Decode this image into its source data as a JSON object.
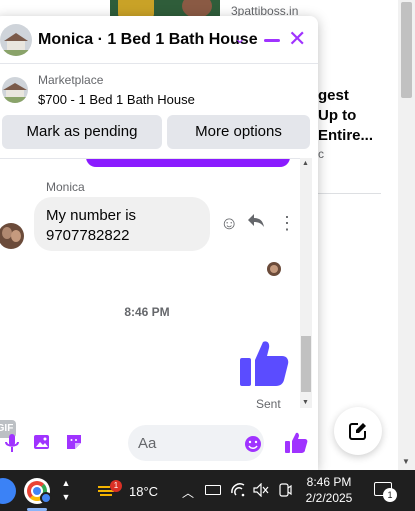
{
  "background": {
    "domain": "3pattiboss.in",
    "ad_title": "gest\nUp to\nEntire...",
    "ad_sub": "c"
  },
  "chat": {
    "title": "Monica · 1 Bed 1 Bath House",
    "marketplace_label": "Marketplace",
    "listing": "$700 - 1 Bed 1 Bath House",
    "pending_button": "Mark as pending",
    "more_button": "More options",
    "sender_name": "Monica",
    "message": "My number is 9707782822",
    "time_divider": "8:46 PM",
    "sent_status": "Sent",
    "composer_placeholder": "Aa",
    "gif_label": "GIF",
    "accent_color": "#a033ff",
    "like_color": "#5b4cff"
  },
  "taskbar": {
    "temperature": "18°C",
    "weather_badge": "1",
    "time": "8:46 PM",
    "date": "2/2/2025",
    "notification_count": "1"
  }
}
